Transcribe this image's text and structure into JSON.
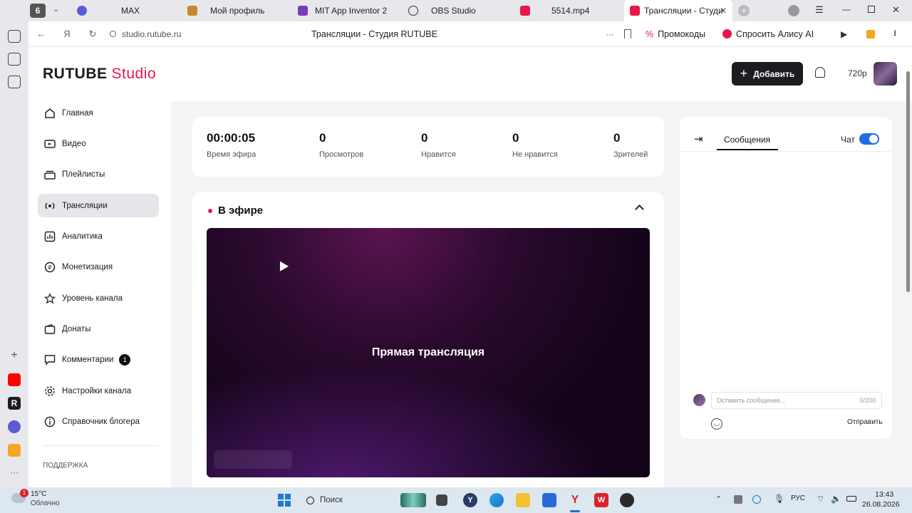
{
  "browser": {
    "tab_counter": "6",
    "tabs": [
      {
        "label": "MAX",
        "icon": "max-icon",
        "color": "#5b5bd6"
      },
      {
        "label": "Мой профиль",
        "icon": "profile-icon",
        "color": "#c48a2a"
      },
      {
        "label": "MIT App Inventor 2",
        "icon": "app-inventor-icon",
        "color": "#7a3db8"
      },
      {
        "label": "OBS Studio",
        "icon": "obs-icon",
        "color": "#333333"
      },
      {
        "label": "5514.mp4",
        "icon": "rutube-icon",
        "color": "#e8164a"
      },
      {
        "label": "Трансляции - Студия",
        "icon": "rutube-studio-icon",
        "color": "#e8164a"
      }
    ],
    "url": "studio.rutube.ru",
    "page_title": "Трансляции - Студия RUTUBE",
    "promo_label": "Промокоды",
    "alice_label": "Спросить Алису AI"
  },
  "header": {
    "logo_main": "RUTUBE",
    "logo_studio": "Studio",
    "add_label": "Добавить",
    "quality_label": "720p"
  },
  "sidebar": {
    "items": [
      {
        "label": "Главная",
        "icon": "home-icon"
      },
      {
        "label": "Видео",
        "icon": "video-icon"
      },
      {
        "label": "Плейлисты",
        "icon": "playlist-icon"
      },
      {
        "label": "Трансляции",
        "icon": "broadcast-icon"
      },
      {
        "label": "Аналитика",
        "icon": "analytics-icon"
      },
      {
        "label": "Монетизация",
        "icon": "monetization-icon"
      },
      {
        "label": "Уровень канала",
        "icon": "star-icon"
      },
      {
        "label": "Донаты",
        "icon": "donate-icon"
      },
      {
        "label": "Комментарии",
        "icon": "comment-icon",
        "badge": "1"
      },
      {
        "label": "Настройки канала",
        "icon": "gear-icon"
      },
      {
        "label": "Справочник блогера",
        "icon": "info-icon"
      }
    ],
    "support_label": "ПОДДЕРЖКА"
  },
  "stats": [
    {
      "value": "00:00:05",
      "label": "Время эфира"
    },
    {
      "value": "0",
      "label": "Просмотров"
    },
    {
      "value": "0",
      "label": "Нравится"
    },
    {
      "value": "0",
      "label": "Не нравится"
    },
    {
      "value": "0",
      "label": "Зрителей"
    }
  ],
  "live": {
    "title": "В эфире",
    "player_text": "Прямая трансляция"
  },
  "chat": {
    "tab_label": "Сообщения",
    "toggle_label": "Чат",
    "input_placeholder": "Оставить сообщение...",
    "counter": "0/200",
    "send_label": "Отправить"
  },
  "taskbar": {
    "weather_temp": "15°C",
    "weather_desc": "Облачно",
    "weather_badge": "1",
    "search_label": "Поиск",
    "lang": "РУС",
    "time": "13:43",
    "date": "26.08.2026"
  },
  "colors": {
    "brand": "#e8164a",
    "live_dot": "#e8164a",
    "toggle": "#1e6fe0"
  }
}
